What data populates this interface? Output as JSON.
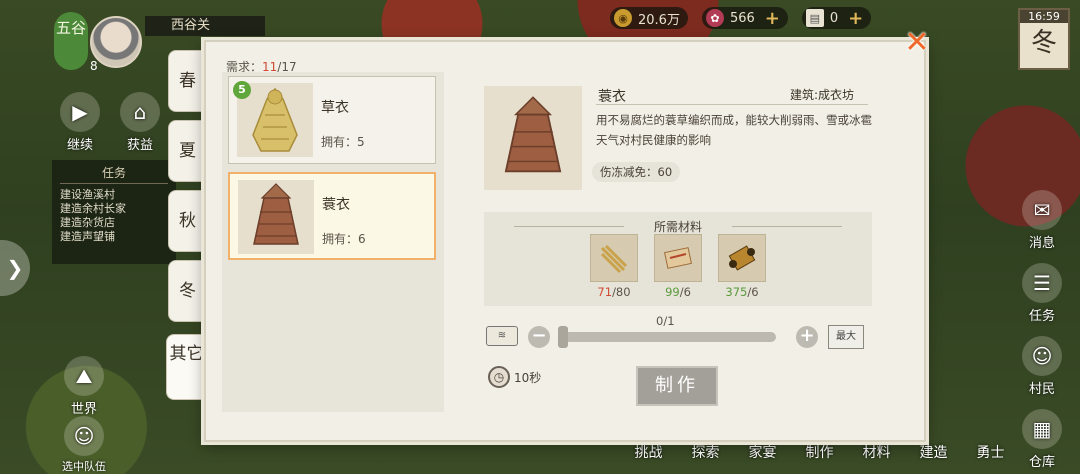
{
  "hud": {
    "season_badge": "五谷",
    "level": "8",
    "location": "西谷关",
    "coins": "20.6万",
    "gems": "566",
    "tickets": "0",
    "clock_time": "16:59",
    "clock_season": "冬",
    "continue_label": "继续",
    "left_btn2_label": "获益",
    "world_label": "世界",
    "team_label": "选中队伍",
    "task_panel": {
      "title": "任务",
      "items": [
        "建设渔溪村",
        "建造余村长家",
        "建造杂货店",
        "建造声望铺"
      ]
    },
    "right_buttons": [
      "消息",
      "任务",
      "村民",
      "仓库"
    ],
    "bottom_nav": [
      "挑战",
      "探索",
      "家宴",
      "制作",
      "材料",
      "建造",
      "勇士"
    ]
  },
  "modal": {
    "requirement_label": "需求：",
    "requirement_current": "11",
    "requirement_total": "/17",
    "tabs": [
      "春",
      "夏",
      "秋",
      "冬",
      "其它"
    ],
    "active_tab": "其它",
    "items": [
      {
        "badge": "5",
        "name": "草衣",
        "owned": "拥有：5"
      },
      {
        "name": "蓑衣",
        "owned": "拥有：6",
        "selected": true
      }
    ],
    "detail": {
      "name": "蓑衣",
      "building": "建筑:成衣坊",
      "description": "用不易腐烂的蓑草编织而成，能较大削弱雨、雪或冰雹天气对村民健康的影响",
      "stat": "伤冻减免：60"
    },
    "materials_title": "所需材料",
    "materials": [
      {
        "icon": "straw-bundle-icon",
        "have": "71",
        "need": "/80",
        "enough": true
      },
      {
        "icon": "cloth-sheet-icon",
        "have": "99",
        "need": "/6",
        "enough": true
      },
      {
        "icon": "thread-spool-icon",
        "have": "375",
        "need": "/6",
        "enough": true
      }
    ],
    "quantity": "0/1",
    "max_label": "最大",
    "duration": "10秒",
    "make_label": "制作"
  }
}
